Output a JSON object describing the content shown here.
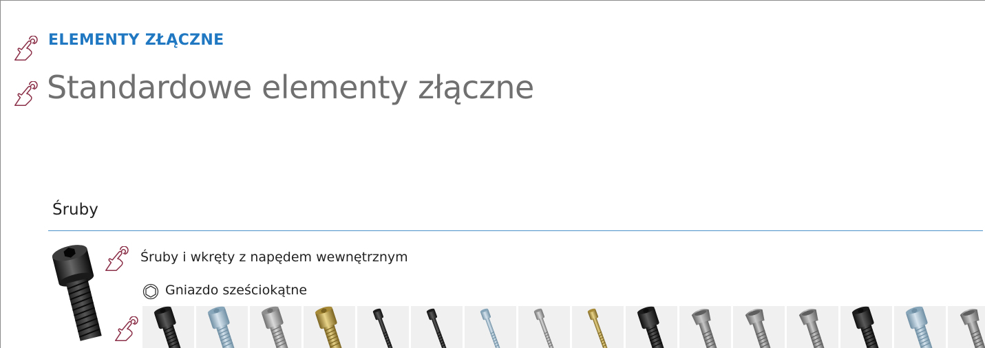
{
  "header": {
    "category": "ELEMENTY ZŁĄCZNE",
    "title": "Standardowe elementy złączne"
  },
  "section": {
    "title": "Śruby",
    "accent_color": "#4a90c9"
  },
  "group": {
    "title": "Śruby i wkręty z napędem wewnętrznym",
    "subgroup": {
      "icon": "hexagon-socket-icon",
      "label": "Gniazdo sześciokątne"
    }
  },
  "colors": {
    "category": "#1f78c1",
    "title": "#707070",
    "cursor": "#8b2f48"
  },
  "products": [
    {
      "name": "black-cap-screw-thumbnail",
      "finish": "black",
      "style": "cap"
    },
    {
      "name": "zinc-blue-cap-screw-thumbnail",
      "finish": "zinc-blue",
      "style": "cap"
    },
    {
      "name": "silver-cap-screw-thumbnail",
      "finish": "silver",
      "style": "cap"
    },
    {
      "name": "yellow-zinc-cap-screw-thumbnail",
      "finish": "yellow",
      "style": "cap"
    },
    {
      "name": "black-thin-screw-thumbnail",
      "finish": "black",
      "style": "thin"
    },
    {
      "name": "black-thin-screw-thumbnail",
      "finish": "black",
      "style": "thin"
    },
    {
      "name": "zinc-blue-thin-screw-thumbnail",
      "finish": "zinc-blue",
      "style": "thin"
    },
    {
      "name": "silver-thin-screw-thumbnail",
      "finish": "silver",
      "style": "thin"
    },
    {
      "name": "yellow-thin-screw-thumbnail",
      "finish": "yellow",
      "style": "thin"
    },
    {
      "name": "black-cap-screw-thumbnail",
      "finish": "black",
      "style": "cap"
    },
    {
      "name": "grey-lowhead-screw-thumbnail",
      "finish": "grey",
      "style": "low"
    },
    {
      "name": "grey-lowhead-screw-thumbnail",
      "finish": "grey",
      "style": "low"
    },
    {
      "name": "grey-lowhead-screw-thumbnail",
      "finish": "grey",
      "style": "low"
    },
    {
      "name": "black-cap-screw-thumbnail",
      "finish": "black",
      "style": "cap"
    },
    {
      "name": "zinc-blue-cap-screw-thumbnail",
      "finish": "zinc-blue",
      "style": "cap"
    },
    {
      "name": "grey-lowhead-screw-thumbnail",
      "finish": "grey",
      "style": "low"
    }
  ]
}
